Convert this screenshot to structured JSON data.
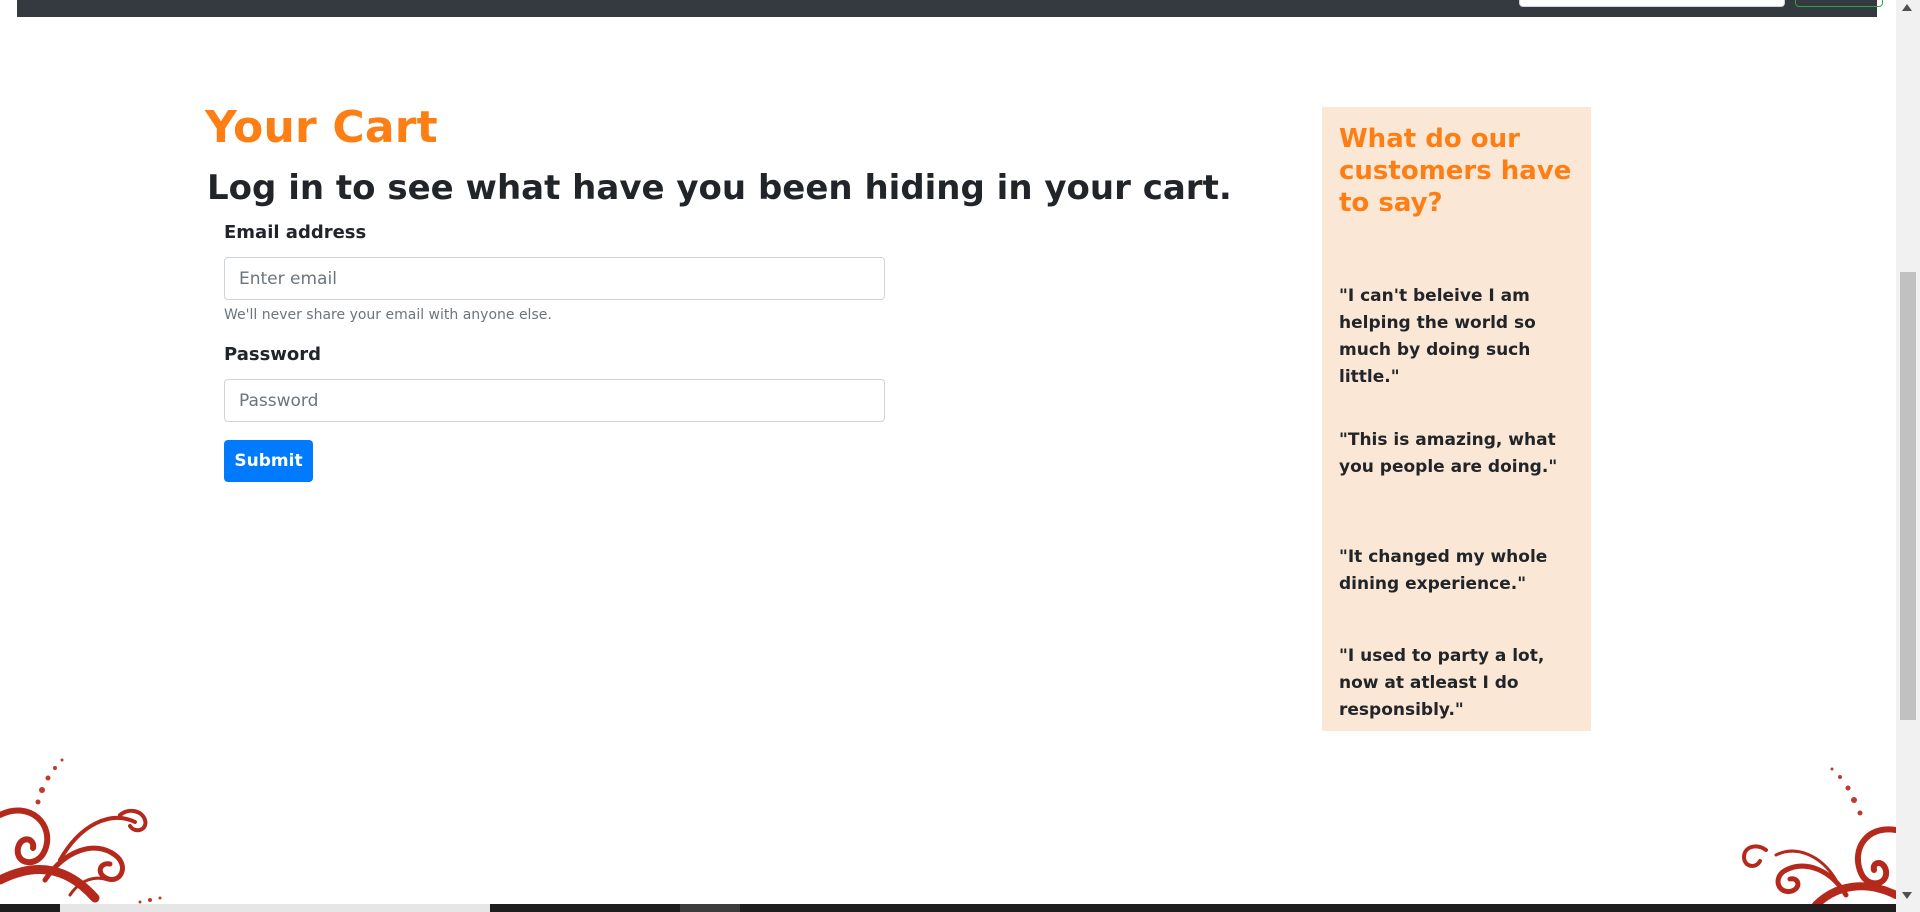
{
  "main": {
    "title": "Your Cart",
    "subtitle": "Log in to see what have you been hiding in your cart."
  },
  "form": {
    "email_label": "Email address",
    "email_placeholder": "Enter email",
    "email_help": "We'll never share your email with anyone else.",
    "password_label": "Password",
    "password_placeholder": "Password",
    "submit_label": "Submit"
  },
  "testimonials": {
    "title": "What do our customers have to say?",
    "quotes": [
      "\"I can't beleive I am helping the world so much by doing such little.\"",
      "\"This is amazing, what you people are doing.\"",
      "\"It changed my whole dining experience.\"",
      "\"I used to party a lot, now at atleast I do responsibly.\""
    ]
  },
  "colors": {
    "accent": "#fd7e14",
    "primary_button": "#007bff",
    "sidebar_bg": "#fae7d5",
    "navbar": "#343a40",
    "swirl": "#b5291c"
  }
}
